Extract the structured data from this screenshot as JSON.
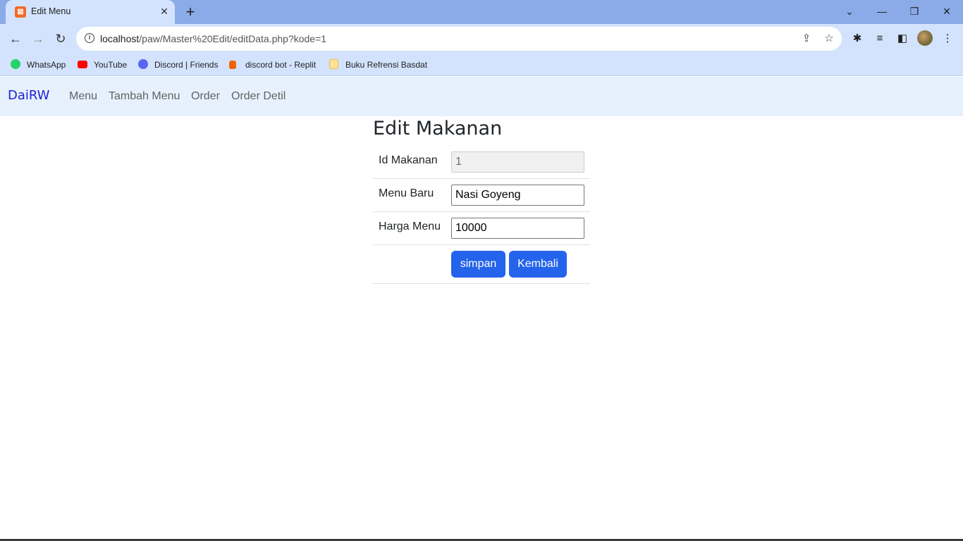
{
  "browser": {
    "tab_title": "Edit Menu",
    "tab_close": "✕",
    "new_tab": "+",
    "window_controls": {
      "dropdown": "⌄",
      "minimize": "—",
      "restore": "❐",
      "close": "✕"
    },
    "url_host": "localhost",
    "url_path": "/paw/Master%20Edit/editData.php?kode=1",
    "bookmarks": [
      {
        "label": "WhatsApp",
        "icon": "whatsapp-icon",
        "color": "#25d366"
      },
      {
        "label": "YouTube",
        "icon": "youtube-icon",
        "color": "#ff0000"
      },
      {
        "label": "Discord | Friends",
        "icon": "discord-icon",
        "color": "#5865f2"
      },
      {
        "label": "discord bot - Replit",
        "icon": "replit-icon",
        "color": "#f26207"
      },
      {
        "label": "Buku Refrensi Basdat",
        "icon": "folder-icon",
        "color": "#fde293"
      }
    ]
  },
  "navbar": {
    "brand": "DaiRW",
    "links": [
      "Menu",
      "Tambah Menu",
      "Order",
      "Order Detil"
    ]
  },
  "form": {
    "title": "Edit Makanan",
    "id_label": "Id Makanan",
    "id_value": "1",
    "menu_label": "Menu Baru",
    "menu_value": "Nasi Goyeng",
    "price_label": "Harga Menu",
    "price_value": "10000",
    "save_label": "simpan",
    "back_label": "Kembali"
  },
  "colors": {
    "primary_button": "#2463eb",
    "brand": "#1b1fd6",
    "navbar_bg": "#e7f1fd"
  }
}
